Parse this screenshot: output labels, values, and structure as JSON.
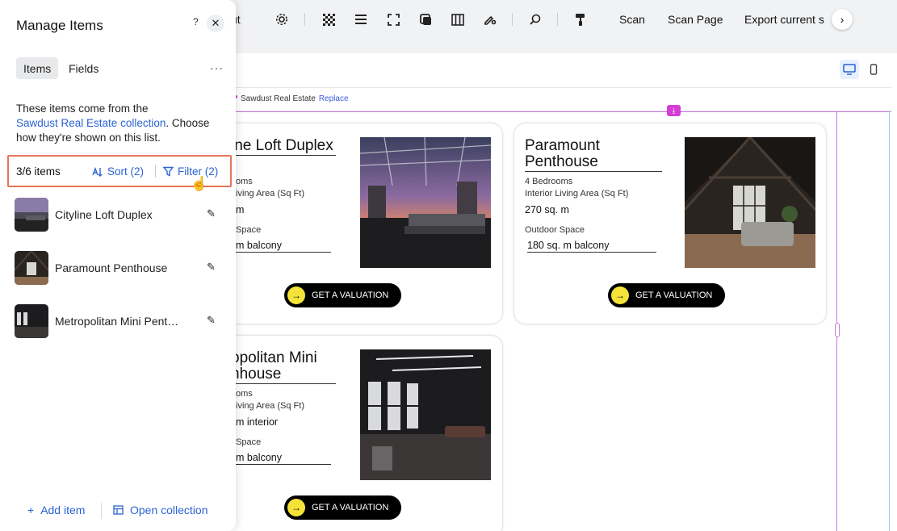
{
  "toolbar": {
    "partial_label": "ut",
    "scan_label": "Scan",
    "scan_page_label": "Scan Page",
    "export_label": "Export current s",
    "next_symbol": "›"
  },
  "breadcrumb": {
    "collection_name": "Sawdust Real Estate",
    "replace_label": "Replace"
  },
  "cards": [
    {
      "title": "ine Loft Duplex",
      "bedrooms_label": "oms",
      "area_label": "iving Area (Sq Ft)",
      "area_value": "m",
      "outdoor_label": "Space",
      "outdoor_value": "m balcony",
      "cta_label": "GET A VALUATION"
    },
    {
      "title": "Paramount Penthouse",
      "bedrooms_label": "4 Bedrooms",
      "area_label": "Interior Living Area (Sq Ft)",
      "area_value": "270 sq. m",
      "outdoor_label": "Outdoor Space",
      "outdoor_value": "180 sq. m balcony",
      "cta_label": "GET A VALUATION"
    },
    {
      "title": "opolitan Mini nhouse",
      "bedrooms_label": "oms",
      "area_label": "iving Area (Sq Ft)",
      "area_value": "m interior",
      "outdoor_label": "Space",
      "outdoor_value": "m balcony",
      "cta_label": "GET A VALUATION"
    }
  ],
  "panel": {
    "title": "Manage Items",
    "help": "?",
    "close": "✕",
    "tabs": [
      {
        "label": "Items",
        "active": true
      },
      {
        "label": "Fields",
        "active": false
      }
    ],
    "more": "···",
    "desc_before": "These items come from the",
    "desc_link": "Sawdust Real Estate collection",
    "desc_after": ". Choose how they're shown on this list.",
    "count": "3/6 items",
    "sort_label": "Sort (2)",
    "filter_label": "Filter (2)",
    "items": [
      {
        "label": "Cityline Loft Duplex"
      },
      {
        "label": "Paramount  Penthouse"
      },
      {
        "label": "Metropolitan Mini Penthouse"
      }
    ],
    "add_label": "Add item",
    "open_label": "Open collection"
  },
  "colors": {
    "accent": "#2a63d4",
    "highlight_box": "#e8735a",
    "repeater_guide": "#c67ad8",
    "cta_arrow": "#f5e33a"
  }
}
